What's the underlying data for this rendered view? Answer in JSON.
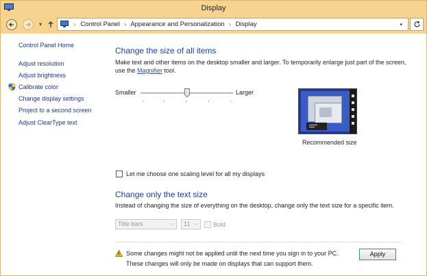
{
  "window": {
    "title": "Display",
    "accent": "#f7d390",
    "app_icon": "display-app-icon"
  },
  "address": {
    "back_icon": "back-arrow-icon",
    "forward_icon": "forward-arrow-icon",
    "recent_icon": "chevron-down-icon",
    "up_icon": "up-arrow-icon",
    "breadcrumbs": [
      "Control Panel",
      "Appearance and Personalization",
      "Display"
    ],
    "refresh_icon": "refresh-icon"
  },
  "sidebar": {
    "home": "Control Panel Home",
    "items": [
      {
        "label": "Adjust resolution"
      },
      {
        "label": "Adjust brightness"
      },
      {
        "label": "Calibrate color",
        "icon": "shield-icon"
      },
      {
        "label": "Change display settings"
      },
      {
        "label": "Project to a second screen"
      },
      {
        "label": "Adjust ClearType text"
      }
    ]
  },
  "main": {
    "heading_size": "Change the size of all items",
    "desc_line1": "Make text and other items on the desktop smaller and larger. To temporarily enlarge just part of the screen,",
    "desc_line2_pre": "use the ",
    "desc_link": "Magnifier",
    "desc_line2_post": " tool.",
    "slider_smaller": "Smaller",
    "slider_larger": "Larger",
    "slider_level": 0.5,
    "preview_caption": "Recommended size",
    "scaling_checkbox_label": "Let me choose one scaling level for all my displays",
    "heading_text": "Change only the text size",
    "text_desc": "Instead of changing the size of everything on the desktop, change only the text size for a specific item.",
    "item_select": "Title bars",
    "size_select": "11",
    "bold_label": "Bold",
    "warning_line1": "Some changes might not be applied until the next time you sign in to your PC.",
    "warning_line2": "These changes will only be made on displays that can support them.",
    "apply_label": "Apply"
  }
}
